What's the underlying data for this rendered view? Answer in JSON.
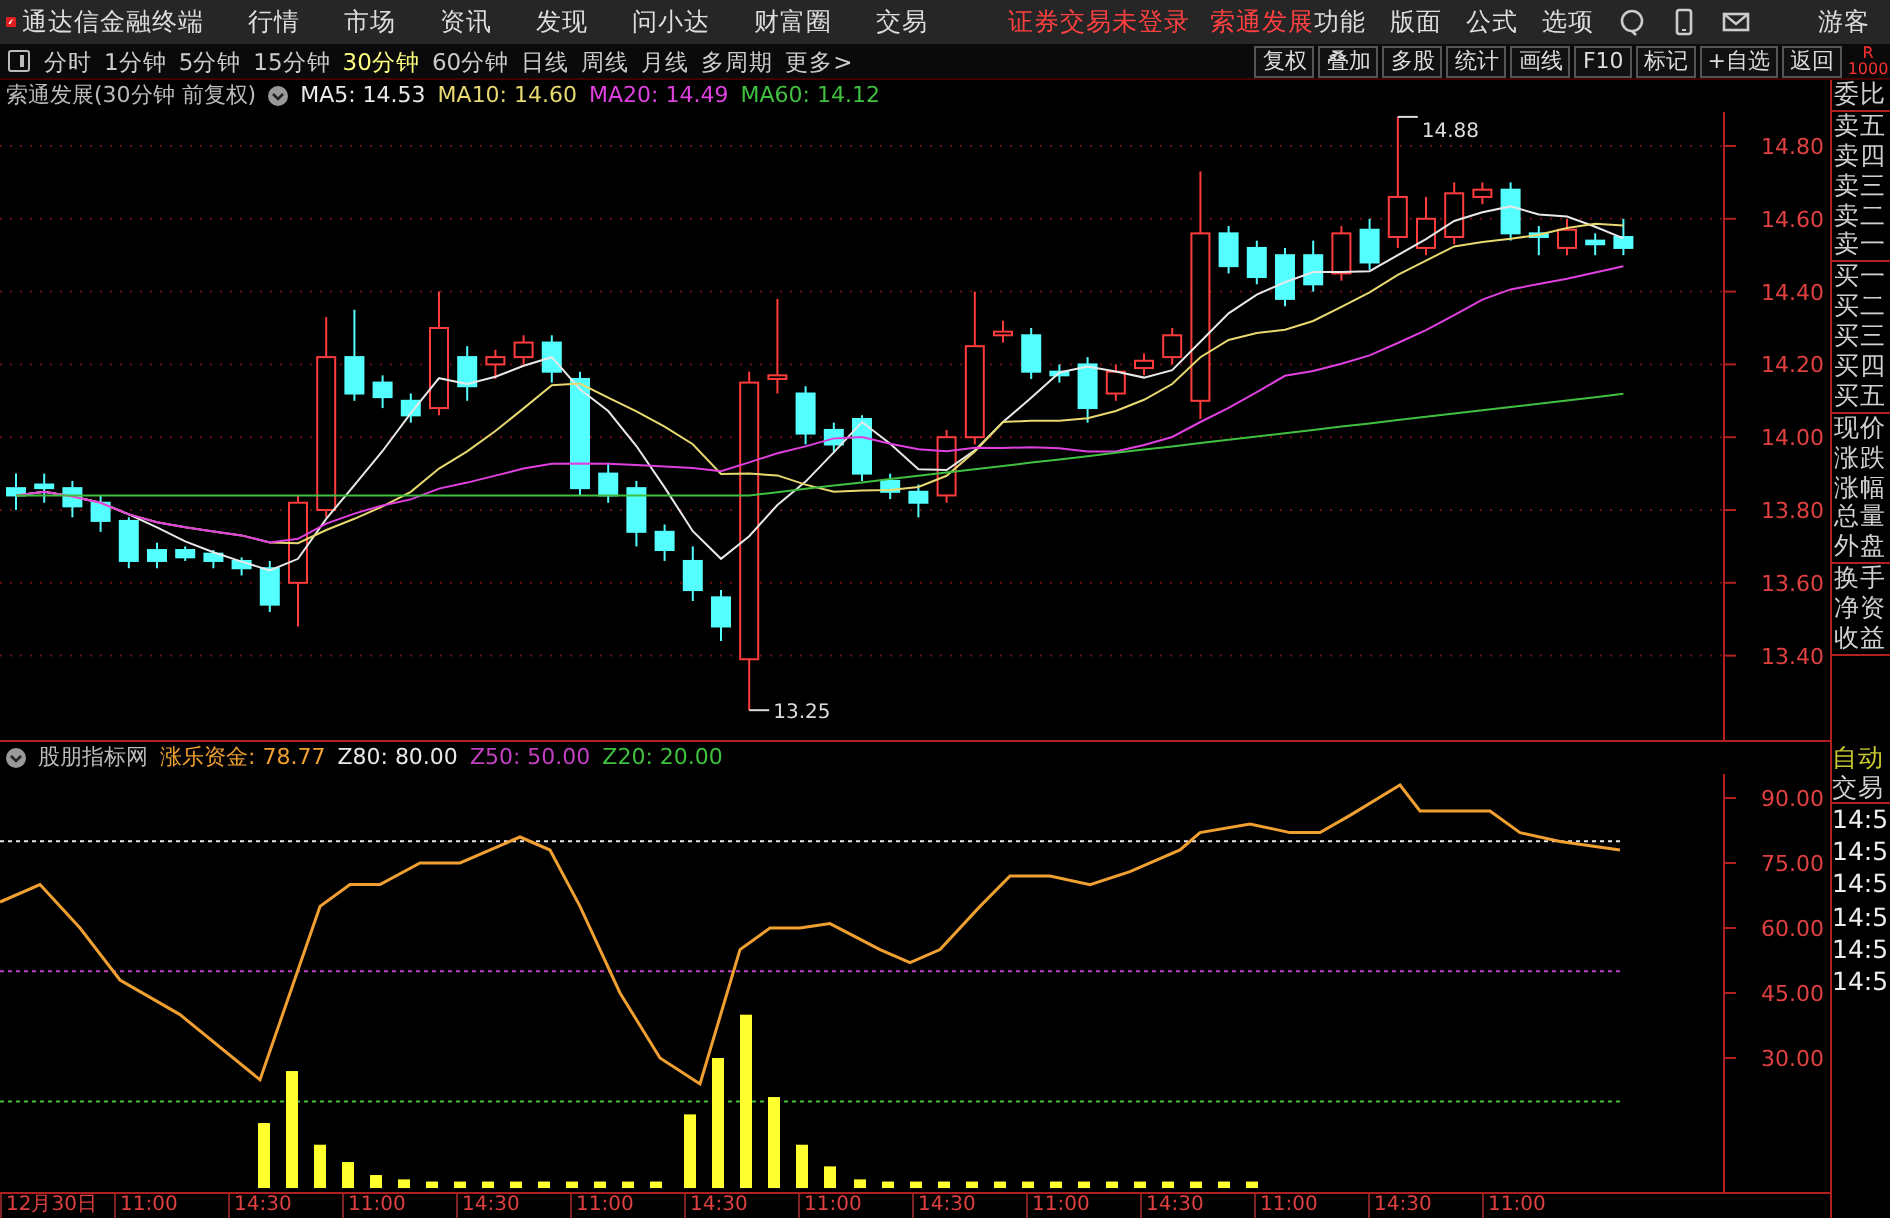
{
  "app_bar": {
    "title": "通达信金融终端",
    "menu": [
      "行情",
      "市场",
      "资讯",
      "发现",
      "问小达",
      "财富圈",
      "交易"
    ],
    "notices": [
      "证券交易未登录",
      "索通发展"
    ],
    "right_menu": [
      "功能",
      "版面",
      "公式",
      "选项"
    ],
    "user": "游客"
  },
  "toolbar": {
    "periods": [
      {
        "label": "分时",
        "selected": false
      },
      {
        "label": "1分钟",
        "selected": false
      },
      {
        "label": "5分钟",
        "selected": false
      },
      {
        "label": "15分钟",
        "selected": false
      },
      {
        "label": "30分钟",
        "selected": true
      },
      {
        "label": "60分钟",
        "selected": false
      },
      {
        "label": "日线",
        "selected": false
      },
      {
        "label": "周线",
        "selected": false
      },
      {
        "label": "月线",
        "selected": false
      },
      {
        "label": "多周期",
        "selected": false
      },
      {
        "label": "更多>",
        "selected": false
      }
    ],
    "buttons": [
      "复权",
      "叠加",
      "多股",
      "统计",
      "画线",
      "F10",
      "标记",
      "+自选",
      "返回"
    ],
    "corner": [
      "R",
      "1000"
    ]
  },
  "main_chart": {
    "title": "索通发展(30分钟 前复权)",
    "indicators": [
      {
        "label": "MA5: 14.53",
        "color": "#e8e8e8"
      },
      {
        "label": "MA10: 14.60",
        "color": "#e8d870"
      },
      {
        "label": "MA20: 14.49",
        "color": "#e040e0"
      },
      {
        "label": "MA60: 14.12",
        "color": "#40c040"
      }
    ],
    "y_axis": [
      "14.80",
      "14.60",
      "14.40",
      "14.20",
      "14.00",
      "13.80",
      "13.60",
      "13.40"
    ],
    "high_label": "14.88",
    "low_label": "13.25"
  },
  "indicator_chart": {
    "title": "股朋指标网",
    "indicators": [
      {
        "label": "涨乐资金: 78.77",
        "color": "#f0a030"
      },
      {
        "label": "Z80: 80.00",
        "color": "#e8e8e8"
      },
      {
        "label": "Z50: 50.00",
        "color": "#c040c0"
      },
      {
        "label": "Z20: 20.00",
        "color": "#40c040"
      }
    ],
    "y_axis": [
      "90.00",
      "75.00",
      "60.00",
      "45.00",
      "30.00"
    ]
  },
  "time_axis": [
    "12月30日",
    "11:00",
    "14:30",
    "11:00",
    "14:30",
    "11:00",
    "14:30",
    "11:00",
    "14:30",
    "11:00",
    "14:30",
    "11:00",
    "14:30",
    "11:00"
  ],
  "side_panel": {
    "groups": [
      [
        "委比"
      ],
      [
        "卖五",
        "卖四",
        "卖三",
        "卖二",
        "卖一"
      ],
      [
        "买一",
        "买二",
        "买三",
        "买四",
        "买五"
      ],
      [
        "现价",
        "涨跌",
        "涨幅",
        "总量",
        "外盘"
      ],
      [
        "换手",
        "净资",
        "收益"
      ]
    ],
    "mode": "自动",
    "trade": "交易",
    "times": [
      "14:5",
      "14:5",
      "14:5",
      "14:5",
      "14:5",
      "14:5"
    ]
  }
}
